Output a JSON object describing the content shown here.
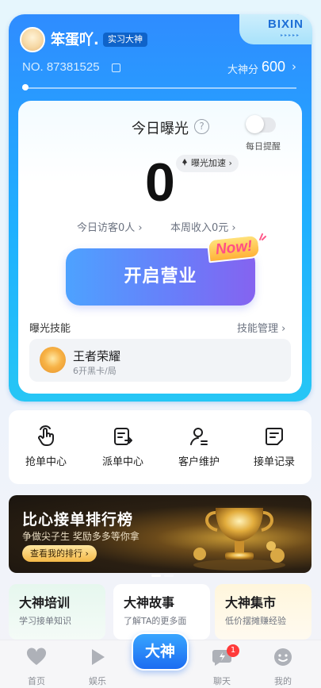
{
  "profile": {
    "nickname": "笨蛋吖.",
    "badge": "实习大神",
    "number": "NO. 87381525",
    "score_label": "大神分",
    "score_value": "600"
  },
  "brand": {
    "text": "BIXIN"
  },
  "exposure": {
    "title": "今日曝光",
    "help_icon": "?",
    "remind_label": "每日提醒",
    "remind_enabled": false,
    "count": "0",
    "boost_label": "曝光加速",
    "visitors": "今日访客0人",
    "income": "本周收入0元"
  },
  "start_business": {
    "label": "开启营业",
    "tag": "Now!"
  },
  "skills": {
    "title": "曝光技能",
    "manage_label": "技能管理",
    "items": [
      {
        "name": "王者荣耀",
        "desc": "6开黑卡/局"
      }
    ]
  },
  "quick_actions": [
    {
      "label": "抢单中心",
      "icon": "tap-hand-icon"
    },
    {
      "label": "派单中心",
      "icon": "dispatch-icon"
    },
    {
      "label": "客户维护",
      "icon": "customer-icon"
    },
    {
      "label": "接单记录",
      "icon": "record-icon"
    }
  ],
  "banner": {
    "title": "比心接单排行榜",
    "subtitle": "争做尖子生  奖励多多等你拿",
    "button": "查看我的排行"
  },
  "features": [
    {
      "title": "大神培训",
      "desc": "学习接单知识",
      "color": "#eaf8ef"
    },
    {
      "title": "大神故事",
      "desc": "了解TA的更多面",
      "color": "#ffffff"
    },
    {
      "title": "大神集市",
      "desc": "低价摆摊赚经验",
      "color": "#fff9e6"
    }
  ],
  "tabbar": {
    "tabs": [
      {
        "label": "首页",
        "icon": "heart-icon"
      },
      {
        "label": "娱乐",
        "icon": "play-icon"
      },
      {
        "label": "聊天",
        "icon": "chat-icon",
        "badge": "1"
      },
      {
        "label": "我的",
        "icon": "face-icon"
      }
    ],
    "center_label": "大神"
  },
  "colors": {
    "primary_blue": "#2f8cff",
    "accent_purple": "#8563f0",
    "now_pink": "#ff4f86"
  }
}
